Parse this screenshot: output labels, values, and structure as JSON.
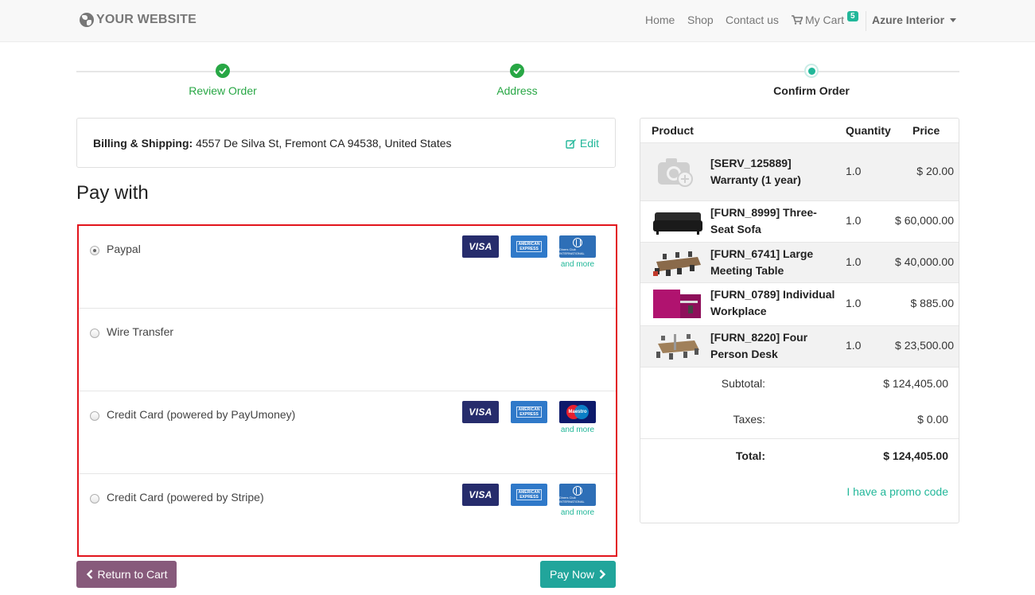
{
  "navbar": {
    "brand": "YOUR WEBSITE",
    "links": {
      "home": "Home",
      "shop": "Shop",
      "contact": "Contact us",
      "cart": "My Cart"
    },
    "cart_count": "5",
    "user": "Azure Interior"
  },
  "wizard": {
    "steps": [
      {
        "label": "Review Order",
        "state": "done"
      },
      {
        "label": "Address",
        "state": "done"
      },
      {
        "label": "Confirm Order",
        "state": "current"
      }
    ]
  },
  "address": {
    "label": "Billing & Shipping:",
    "value": "4557 De Silva St, Fremont CA 94538, United States",
    "edit_label": "Edit"
  },
  "pay_with_title": "Pay with",
  "payment_methods": [
    {
      "label": "Paypal",
      "selected": true,
      "cards": [
        "visa",
        "amex",
        "diners"
      ],
      "and_more": "and more"
    },
    {
      "label": "Wire Transfer",
      "selected": false,
      "cards": []
    },
    {
      "label": "Credit Card (powered by PayUmoney)",
      "selected": false,
      "cards": [
        "visa",
        "amex",
        "maestro"
      ],
      "and_more": "and more"
    },
    {
      "label": "Credit Card (powered by Stripe)",
      "selected": false,
      "cards": [
        "visa",
        "amex",
        "diners"
      ],
      "and_more": "and more"
    }
  ],
  "card_text": {
    "visa": "VISA",
    "amex": "AMERICAN EXPRESS",
    "diners": "Diners Club INTERNATIONAL",
    "maestro": "Maestro"
  },
  "buttons": {
    "return": "Return to Cart",
    "pay": "Pay Now"
  },
  "summary": {
    "headers": {
      "product": "Product",
      "quantity": "Quantity",
      "price": "Price"
    },
    "items": [
      {
        "name": "[SERV_125889] Warranty (1 year)",
        "qty": "1.0",
        "price": "$ 20.00"
      },
      {
        "name": "[FURN_8999] Three-Seat Sofa",
        "qty": "1.0",
        "price": "$ 60,000.00"
      },
      {
        "name": "[FURN_6741] Large Meeting Table",
        "qty": "1.0",
        "price": "$ 40,000.00"
      },
      {
        "name": "[FURN_0789] Individual Workplace",
        "qty": "1.0",
        "price": "$ 885.00"
      },
      {
        "name": "[FURN_8220] Four Person Desk",
        "qty": "1.0",
        "price": "$ 23,500.00"
      }
    ],
    "subtotal_label": "Subtotal:",
    "subtotal": "$ 124,405.00",
    "taxes_label": "Taxes:",
    "taxes": "$ 0.00",
    "total_label": "Total:",
    "total": "$ 124,405.00",
    "promo": "I have a promo code"
  },
  "colors": {
    "accent": "#21b799",
    "primary": "#875a7b",
    "pay_button": "#21a59b",
    "success": "#28a745",
    "highlight_border": "#e2141c"
  }
}
